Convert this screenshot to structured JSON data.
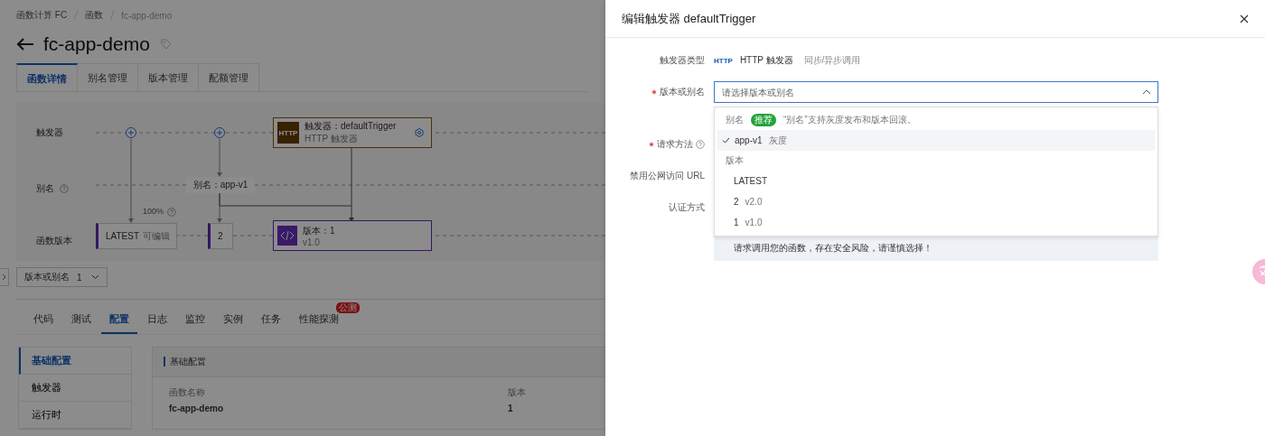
{
  "breadcrumb": [
    "函数计算 FC",
    "函数",
    "fc-app-demo"
  ],
  "title": "fc-app-demo",
  "tabs": [
    {
      "label": "函数详情",
      "selected": true
    },
    {
      "label": "别名管理",
      "selected": false
    },
    {
      "label": "版本管理",
      "selected": false
    },
    {
      "label": "配额管理",
      "selected": false
    }
  ],
  "diagram": {
    "rows": [
      {
        "label": "触发器",
        "help": false
      },
      {
        "label": "别名",
        "help": true
      },
      {
        "label": "函数版本",
        "help": false
      }
    ],
    "trigger": {
      "badge": "HTTP",
      "title": "触发器：defaultTrigger",
      "subtitle": "HTTP 触发器"
    },
    "alias": "别名：app-v1",
    "weight": "100%",
    "versions": [
      {
        "kind": "tag",
        "label": "LATEST",
        "note": "可编辑"
      },
      {
        "kind": "tag",
        "label": "2"
      },
      {
        "kind": "card",
        "label": "版本：1",
        "note": "v1.0"
      }
    ]
  },
  "version_select": {
    "label": "版本或别名",
    "value": "1"
  },
  "subtabs": [
    {
      "label": "代码",
      "selected": false
    },
    {
      "label": "测试",
      "selected": false
    },
    {
      "label": "配置",
      "selected": true
    },
    {
      "label": "日志",
      "selected": false
    },
    {
      "label": "监控",
      "selected": false
    },
    {
      "label": "实例",
      "selected": false
    },
    {
      "label": "任务",
      "selected": false
    },
    {
      "label": "性能探测",
      "selected": false,
      "badge": "公测"
    }
  ],
  "side_menu": [
    {
      "label": "基础配置",
      "selected": true
    },
    {
      "label": "触发器",
      "selected": false
    },
    {
      "label": "运行时",
      "selected": false
    }
  ],
  "panel": {
    "title": "基础配置",
    "fields": [
      {
        "label": "函数名称",
        "value": "fc-app-demo"
      },
      {
        "label": "版本",
        "value": "1"
      }
    ]
  },
  "drawer": {
    "title": "编辑触发器 defaultTrigger",
    "trigger_type": {
      "label": "触发器类型",
      "badge": "HTTP",
      "name": "HTTP 触发器",
      "mode": "同步/异步调用"
    },
    "version_alias": {
      "label": "版本或别名",
      "required": true,
      "placeholder": "请选择版本或别名",
      "expanded": true
    },
    "dropdown": [
      {
        "label": "别名",
        "tag": "推荐",
        "hint": "“别名”支持灰度发布和版本回滚。",
        "options": [
          {
            "label": "app-v1",
            "note": "灰度",
            "selected": true
          }
        ]
      },
      {
        "label": "版本",
        "options": [
          {
            "label": "LATEST",
            "selected": false
          },
          {
            "label": "2",
            "note": "v2.0",
            "selected": false
          },
          {
            "label": "1",
            "note": "v1.0",
            "selected": false
          }
        ]
      }
    ],
    "fields": [
      {
        "label": "请求方法",
        "required": true,
        "help": true
      },
      {
        "label": "禁用公网访问 URL",
        "required": false,
        "help": false
      },
      {
        "label": "认证方式",
        "required": false,
        "help": false
      }
    ],
    "notice": "请求调用您的函数，存在安全风险，请谨慎选择！"
  }
}
